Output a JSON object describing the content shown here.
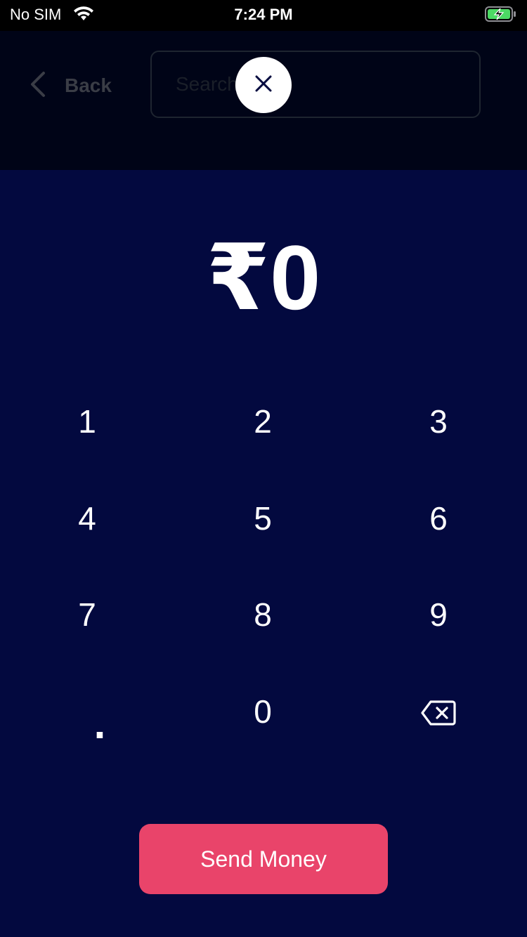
{
  "status_bar": {
    "carrier": "No SIM",
    "time": "7:24 PM",
    "wifi_icon": "wifi-icon",
    "battery_icon": "battery-charging-icon",
    "battery_color": "#4cd964"
  },
  "header": {
    "back_label": "Back",
    "back_icon": "chevron-left-icon",
    "search_placeholder": "Search",
    "close_icon": "close-icon"
  },
  "amount": {
    "display": "₹0"
  },
  "keypad": {
    "keys": [
      "1",
      "2",
      "3",
      "4",
      "5",
      "6",
      "7",
      "8",
      "9",
      ".",
      "0"
    ],
    "backspace_icon": "backspace-icon"
  },
  "send_button": {
    "label": "Send Money",
    "color": "#e9446a"
  },
  "colors": {
    "background": "#03093f",
    "header_overlay": "#000417"
  }
}
